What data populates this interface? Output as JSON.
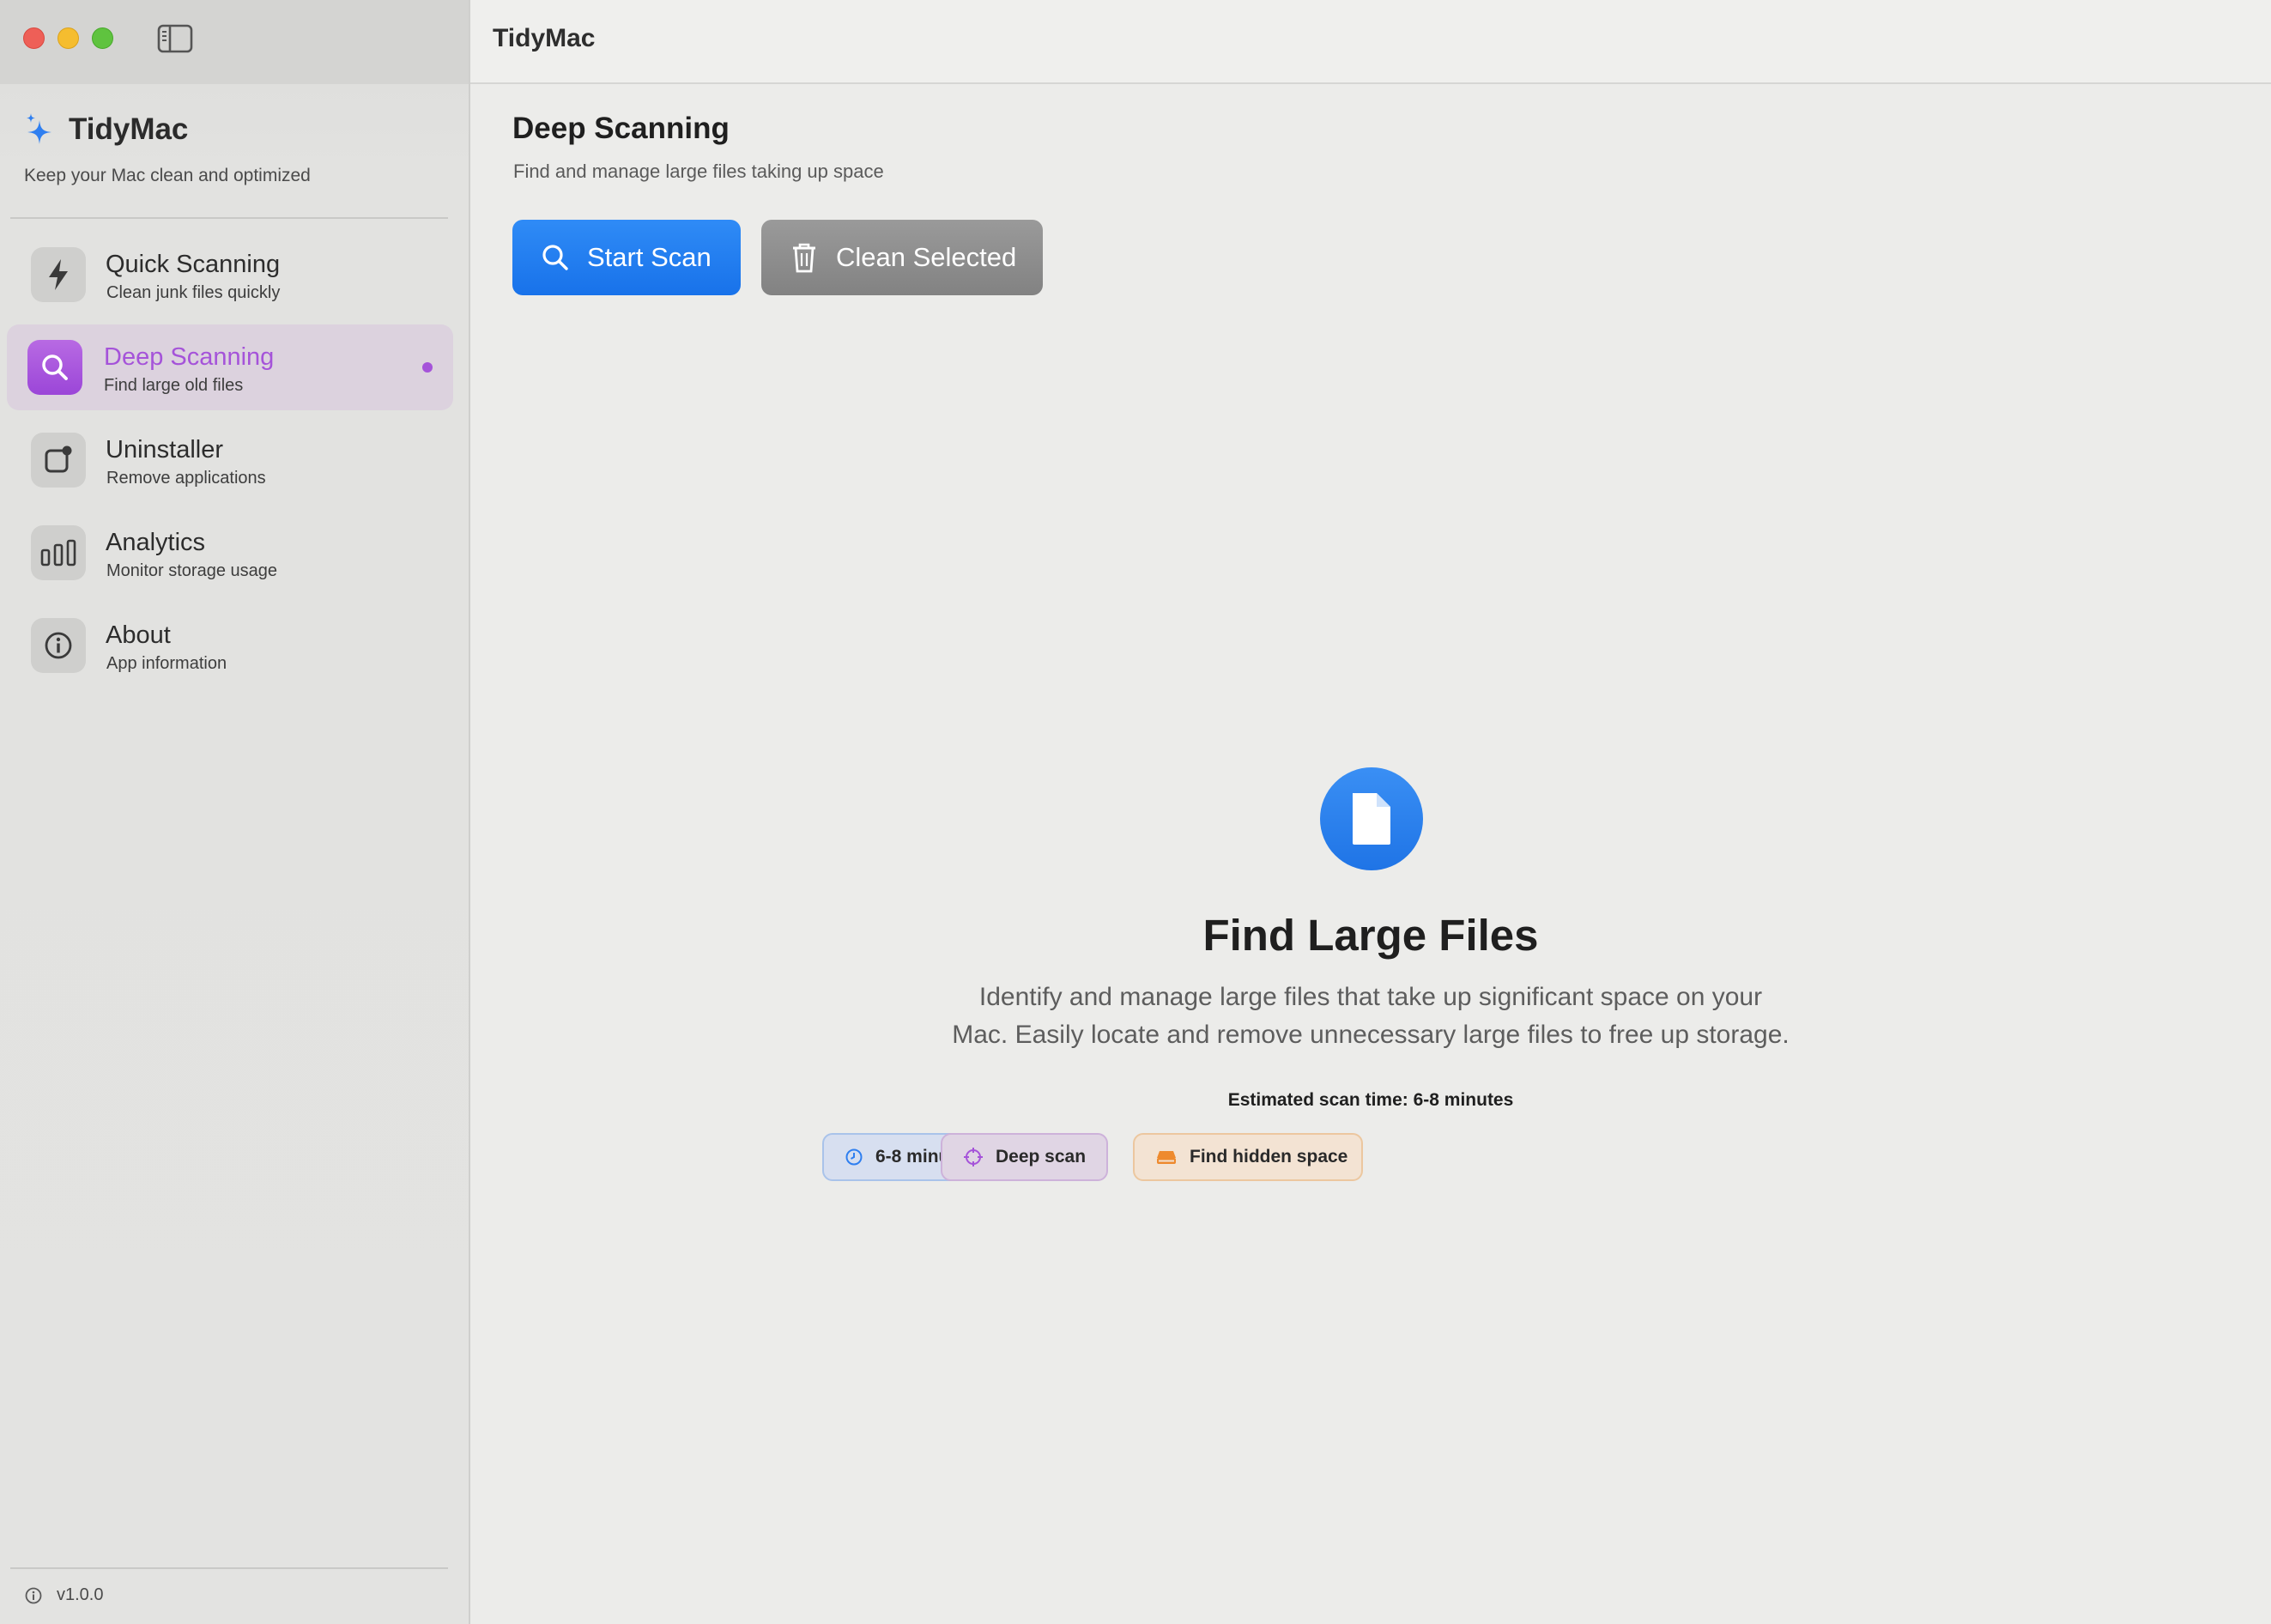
{
  "window": {
    "title": "TidyMac"
  },
  "sidebar": {
    "brand_name": "TidyMac",
    "tagline": "Keep your Mac clean and optimized",
    "items": [
      {
        "title": "Quick Scanning",
        "subtitle": "Clean junk files quickly",
        "icon": "bolt-icon",
        "active": false
      },
      {
        "title": "Deep Scanning",
        "subtitle": "Find large old files",
        "icon": "magnifier-icon",
        "active": true
      },
      {
        "title": "Uninstaller",
        "subtitle": "Remove applications",
        "icon": "app-remove-icon",
        "active": false
      },
      {
        "title": "Analytics",
        "subtitle": "Monitor storage usage",
        "icon": "bar-chart-icon",
        "active": false
      },
      {
        "title": "About",
        "subtitle": "App information",
        "icon": "info-icon",
        "active": false
      }
    ],
    "version": "v1.0.0"
  },
  "main": {
    "page_title": "Deep Scanning",
    "page_subtitle": "Find and manage large files taking up space",
    "start_scan_label": "Start Scan",
    "clean_selected_label": "Clean Selected",
    "hero_title": "Find Large Files",
    "hero_desc_line1": "Identify and manage large files that take up significant space on your",
    "hero_desc_line2": "Mac. Easily locate and remove unnecessary large files to free up storage.",
    "scan_time": "Estimated scan time: 6-8 minutes",
    "chips": [
      {
        "label": "6-8 minutes",
        "icon": "clock-icon"
      },
      {
        "label": "Deep scan",
        "icon": "target-icon"
      },
      {
        "label": "Find hidden space",
        "icon": "drive-icon"
      }
    ]
  },
  "colors": {
    "accent_blue": "#1f74e6",
    "accent_purple": "#a553d9",
    "clean_button_gray": "#8a8a8a",
    "traffic_red": "#ee5f57",
    "traffic_yellow": "#f5bd2f",
    "traffic_green": "#5fc33f"
  }
}
